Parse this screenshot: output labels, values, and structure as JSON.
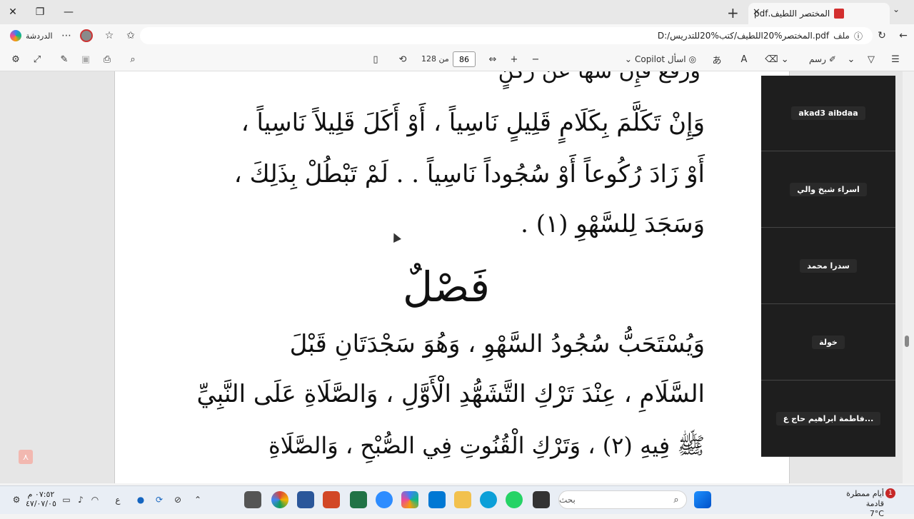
{
  "window": {
    "tab_title": "المختصر اللطيف.pdf",
    "minimize": "—",
    "restore": "❐",
    "close": "✕"
  },
  "address": {
    "file_label": "ملف",
    "url": "D:/المختصر%20اللطيف/كتب%20للتدريس.pdf",
    "chat_label": "الدردشة"
  },
  "pdf_toolbar": {
    "page_current": "86",
    "page_of": "من 128",
    "copilot_label": "اسأل Copilot",
    "draw_label": "رسم"
  },
  "document": {
    "top_cut": "وَرَفَعَ فَإِنْ سَهَا عَنْ رُكْنٍ",
    "line1": "وَإِنْ تَكَلَّمَ بِكَلَامٍ قَلِيلٍ نَاسِياً ، أَوْ أَكَلَ قَلِيلاً نَاسِياً ،",
    "line2": "أَوْ زَادَ رُكُوعاً أَوْ سُجُوداً نَاسِياً . . لَمْ تَبْطُلْ بِذَلِكَ ،",
    "line3": "وَسَجَدَ لِلسَّهْوِ (١) .",
    "heading": "فَصْلٌ",
    "line4": "وَيُسْتَحَبُّ سُجُودُ السَّهْوِ ، وَهُوَ سَجْدَتَانِ قَبْلَ",
    "line5": "السَّلَامِ ، عِنْدَ تَرْكِ التَّشَهُّدِ الْأَوَّلِ ، وَالصَّلَاةِ عَلَى النَّبِيِّ",
    "line6": "ﷺ فِيهِ (٢) ، وَتَرْكِ الْقُنُوتِ فِي الصُّبْحِ ، وَالصَّلَاةِ"
  },
  "participants": [
    {
      "name": "akad3 aibdaa"
    },
    {
      "name": "اسراء شيخ والي"
    },
    {
      "name": "سدرا محمد"
    },
    {
      "name": "خولة"
    },
    {
      "name": "فاطمة ابراهيم حاج ع..."
    }
  ],
  "taskbar": {
    "search_placeholder": "بحث",
    "weather_text": "أيام ممطرة قادمة",
    "temperature": "7°C",
    "notif_count": "1",
    "time": "٠٧:٥٢ م",
    "date": "٤٧/٠٧/٠٥",
    "lang": "ع"
  }
}
